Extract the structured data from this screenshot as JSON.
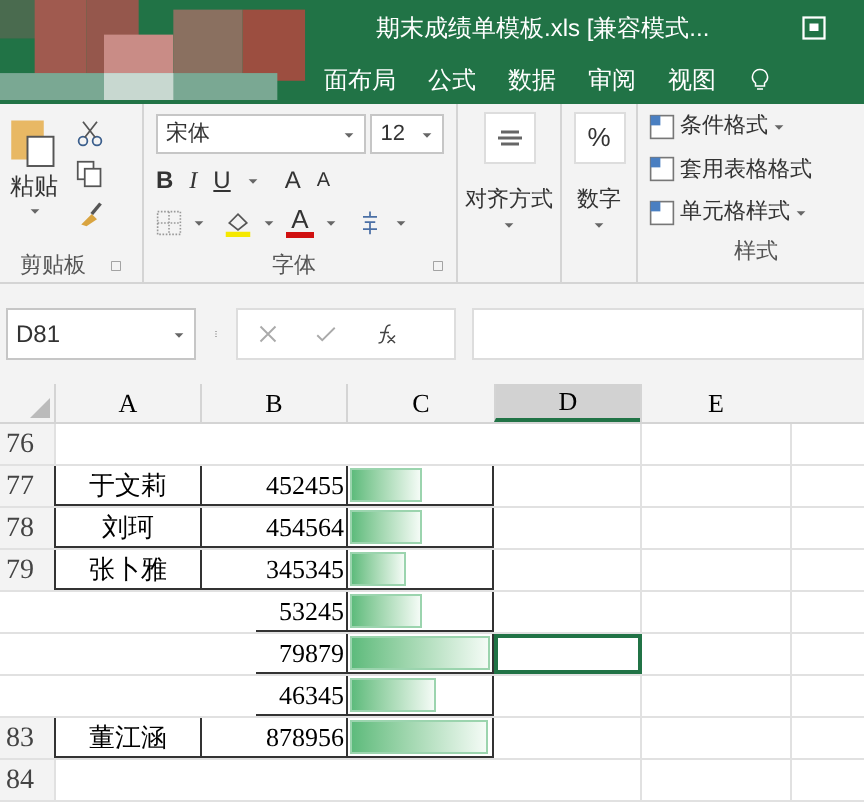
{
  "window": {
    "title": "期末成绩单模板.xls  [兼容模式..."
  },
  "ribbon_tabs": [
    {
      "label": "面布局",
      "selected": false
    },
    {
      "label": "公式",
      "selected": false
    },
    {
      "label": "数据",
      "selected": false
    },
    {
      "label": "审阅",
      "selected": false
    },
    {
      "label": "视图",
      "selected": false
    }
  ],
  "ribbon": {
    "clipboard": {
      "paste": "粘贴",
      "group_label": "剪贴板"
    },
    "font": {
      "name": "宋体",
      "size": "12",
      "bold": "B",
      "italic": "I",
      "underline": "U",
      "grow": "A",
      "shrink": "A",
      "color_letter": "A",
      "group_label": "字体"
    },
    "alignment": {
      "label": "对齐方式"
    },
    "number": {
      "symbol": "%",
      "label": "数字"
    },
    "styles": {
      "items": [
        "条件格式",
        "套用表格格式",
        "单元格样式"
      ],
      "group_label": "样式"
    }
  },
  "formula_bar": {
    "name_box": "D81"
  },
  "sheet": {
    "columns": [
      {
        "label": "A",
        "selected": false
      },
      {
        "label": "B",
        "selected": false
      },
      {
        "label": "C",
        "selected": false
      },
      {
        "label": "D",
        "selected": true
      },
      {
        "label": "E",
        "selected": false
      }
    ],
    "rows": [
      {
        "number": "76",
        "kind": "blank",
        "selected": false
      },
      {
        "number": "77",
        "kind": "data",
        "name": "于文莉",
        "value": "452455",
        "level": 0.52,
        "selected": false
      },
      {
        "number": "78",
        "kind": "data",
        "name": "刘珂",
        "value": "454564",
        "level": 0.52,
        "selected": false
      },
      {
        "number": "79",
        "kind": "data",
        "name": "张卜雅",
        "value": "345345",
        "level": 0.4,
        "selected": false
      },
      {
        "kind": "data",
        "value": "53245",
        "level": 0.52,
        "selected": false
      },
      {
        "kind": "data",
        "value": "79879",
        "level": 1.0,
        "selected": true
      },
      {
        "kind": "data",
        "value": "46345",
        "level": 0.62,
        "selected": false
      },
      {
        "number": "83",
        "kind": "data",
        "name": "董江涵",
        "value": "878956",
        "level": 0.98,
        "selected": false
      },
      {
        "number": "84",
        "kind": "blank",
        "selected": false
      }
    ]
  }
}
